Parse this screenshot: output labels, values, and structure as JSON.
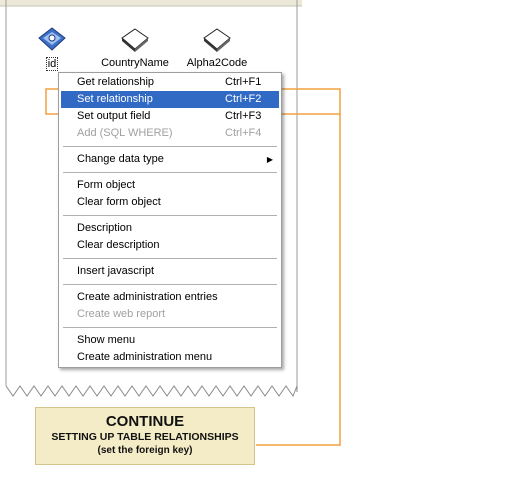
{
  "fields": [
    {
      "name": "id",
      "icon": "key-field-icon",
      "selected": true
    },
    {
      "name": "CountryName",
      "icon": "field-icon",
      "selected": false
    },
    {
      "name": "Alpha2Code",
      "icon": "field-icon",
      "selected": false
    }
  ],
  "context_menu": {
    "groups": [
      [
        {
          "label": "Get relationship",
          "shortcut": "Ctrl+F1",
          "state": "normal"
        },
        {
          "label": "Set relationship",
          "shortcut": "Ctrl+F2",
          "state": "active"
        },
        {
          "label": "Set output field",
          "shortcut": "Ctrl+F3",
          "state": "normal"
        },
        {
          "label": "Add (SQL WHERE)",
          "shortcut": "Ctrl+F4",
          "state": "disabled"
        }
      ],
      [
        {
          "label": "Change data type",
          "shortcut": "",
          "state": "normal",
          "submenu": true
        }
      ],
      [
        {
          "label": "Form object",
          "shortcut": "",
          "state": "normal"
        },
        {
          "label": "Clear form object",
          "shortcut": "",
          "state": "normal"
        }
      ],
      [
        {
          "label": "Description",
          "shortcut": "",
          "state": "normal"
        },
        {
          "label": "Clear description",
          "shortcut": "",
          "state": "normal"
        }
      ],
      [
        {
          "label": "Insert javascript",
          "shortcut": "",
          "state": "normal"
        }
      ],
      [
        {
          "label": "Create administration entries",
          "shortcut": "",
          "state": "normal"
        },
        {
          "label": "Create web report",
          "shortcut": "",
          "state": "disabled"
        }
      ],
      [
        {
          "label": "Show menu",
          "shortcut": "",
          "state": "normal"
        },
        {
          "label": "Create administration menu",
          "shortcut": "",
          "state": "normal"
        }
      ]
    ]
  },
  "callout": {
    "title": "CONTINUE",
    "subtitle": "SETTING UP TABLE RELATIONSHIPS",
    "note": "(set the foreign key)"
  },
  "colors": {
    "highlight": "#316ac5",
    "callout_line": "#f0a040",
    "callout_bg": "#f3ecc6",
    "menu_bg": "#ffffff",
    "disabled_text": "#a0a0a0"
  }
}
